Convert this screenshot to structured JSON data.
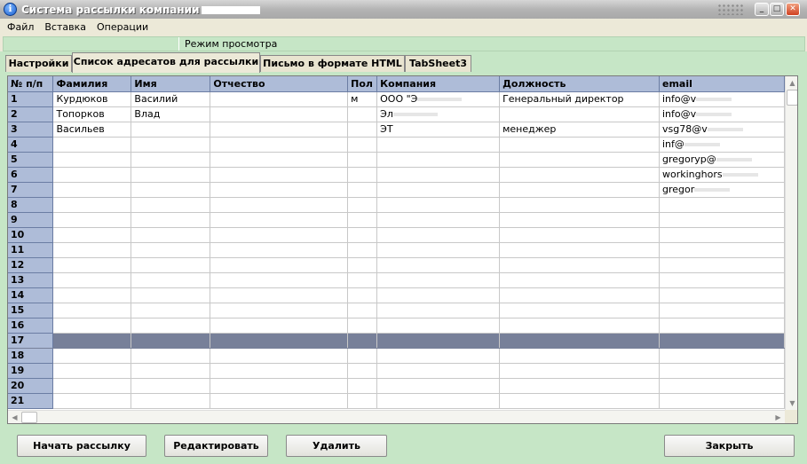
{
  "window": {
    "title": "Система рассылки компании"
  },
  "menu": [
    "Файл",
    "Вставка",
    "Операции"
  ],
  "status": {
    "mode": "Режим просмотра"
  },
  "tabs": [
    {
      "label": "Настройки",
      "active": false
    },
    {
      "label": "Список адресатов для рассылки",
      "active": true
    },
    {
      "label": "Письмо в формате HTML",
      "active": false
    },
    {
      "label": "TabSheet3",
      "active": false
    }
  ],
  "grid": {
    "columns": [
      "№ п/п",
      "Фамилия",
      "Имя",
      "Отчество",
      "Пол",
      "Компания",
      "Должность",
      "email"
    ],
    "selected_row": "17",
    "rows": [
      [
        "1",
        "Курдюков",
        "Василий",
        "",
        "м",
        "ООО \"Э",
        "Генеральный директор",
        "info@v"
      ],
      [
        "2",
        "Топорков",
        "Влад",
        "",
        "",
        "Эл",
        "",
        "info@v"
      ],
      [
        "3",
        "Васильев",
        "",
        "",
        "",
        "ЭТ",
        "менеджер",
        "vsg78@v"
      ],
      [
        "4",
        "",
        "",
        "",
        "",
        "",
        "",
        "inf@"
      ],
      [
        "5",
        "",
        "",
        "",
        "",
        "",
        "",
        "gregoryp@"
      ],
      [
        "6",
        "",
        "",
        "",
        "",
        "",
        "",
        "workinghors"
      ],
      [
        "7",
        "",
        "",
        "",
        "",
        "",
        "",
        "gregor"
      ],
      [
        "8",
        "",
        "",
        "",
        "",
        "",
        "",
        ""
      ],
      [
        "9",
        "",
        "",
        "",
        "",
        "",
        "",
        ""
      ],
      [
        "10",
        "",
        "",
        "",
        "",
        "",
        "",
        ""
      ],
      [
        "11",
        "",
        "",
        "",
        "",
        "",
        "",
        ""
      ],
      [
        "12",
        "",
        "",
        "",
        "",
        "",
        "",
        ""
      ],
      [
        "13",
        "",
        "",
        "",
        "",
        "",
        "",
        ""
      ],
      [
        "14",
        "",
        "",
        "",
        "",
        "",
        "",
        ""
      ],
      [
        "15",
        "",
        "",
        "",
        "",
        "",
        "",
        ""
      ],
      [
        "16",
        "",
        "",
        "",
        "",
        "",
        "",
        ""
      ],
      [
        "17",
        "",
        "",
        "",
        "",
        "",
        "",
        ""
      ],
      [
        "18",
        "",
        "",
        "",
        "",
        "",
        "",
        ""
      ],
      [
        "19",
        "",
        "",
        "",
        "",
        "",
        "",
        ""
      ],
      [
        "20",
        "",
        "",
        "",
        "",
        "",
        "",
        ""
      ],
      [
        "21",
        "",
        "",
        "",
        "",
        "",
        "",
        ""
      ]
    ]
  },
  "buttons": {
    "start": "Начать рассылку",
    "edit": "Редактировать",
    "delete": "Удалить",
    "close": "Закрыть"
  },
  "colors": {
    "panel_green": "#c6e6c6",
    "header_blue": "#aebcd8",
    "selection": "#778099"
  }
}
